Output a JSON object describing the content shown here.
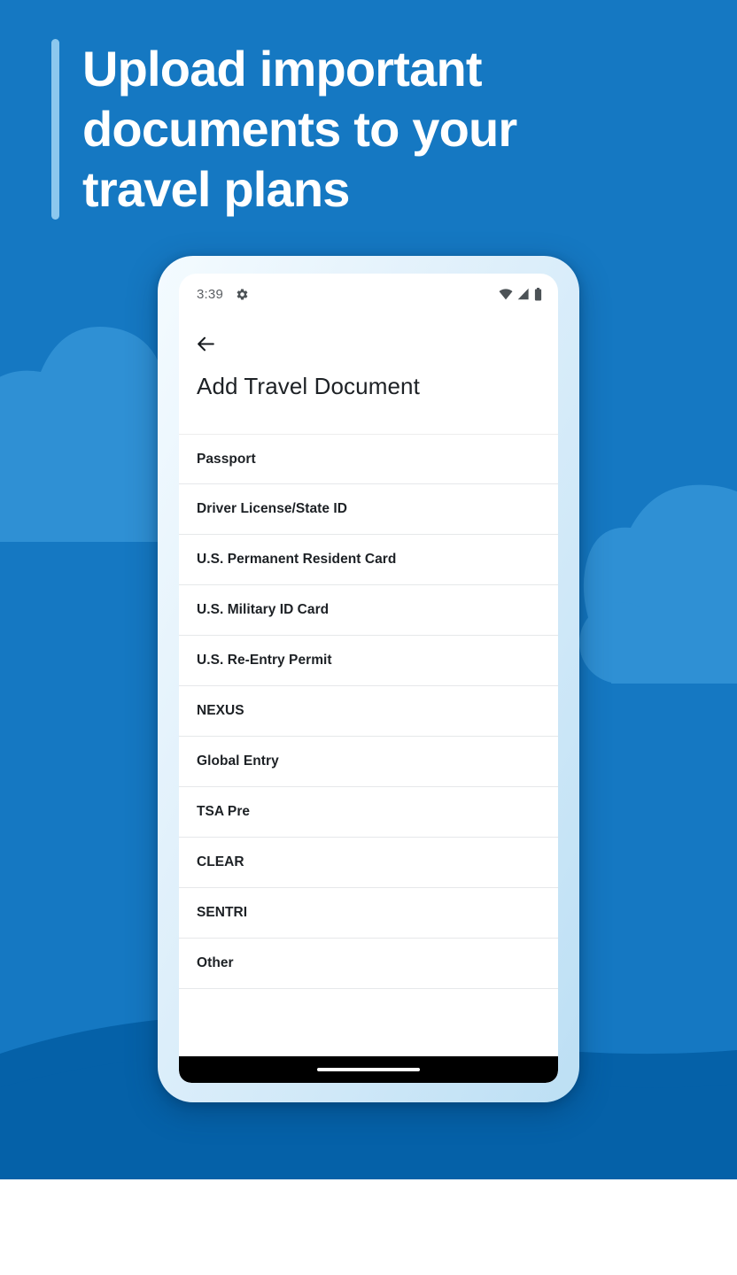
{
  "promo": {
    "headline": "Upload important\ndocuments to your\ntravel plans",
    "accent_color": "#8cc8ee",
    "background_color": "#1578c2",
    "background_color_dark": "#0561a8",
    "cloud_color": "#2f90d4"
  },
  "phone": {
    "status_bar": {
      "time": "3:39",
      "icons": [
        "gear-icon",
        "wifi-icon",
        "cellular-signal-icon",
        "battery-icon"
      ]
    },
    "app_bar": {
      "back_icon": "arrow-left-icon",
      "title": "Add Travel Document"
    },
    "document_types": [
      {
        "label": "Passport"
      },
      {
        "label": "Driver License/State ID"
      },
      {
        "label": "U.S. Permanent Resident Card"
      },
      {
        "label": "U.S. Military ID Card"
      },
      {
        "label": "U.S. Re-Entry Permit"
      },
      {
        "label": "NEXUS"
      },
      {
        "label": "Global Entry"
      },
      {
        "label": "TSA Pre"
      },
      {
        "label": "CLEAR"
      },
      {
        "label": "SENTRI"
      },
      {
        "label": "Other"
      }
    ],
    "gesture_nav": {
      "handle": "home-gesture-handle"
    }
  }
}
